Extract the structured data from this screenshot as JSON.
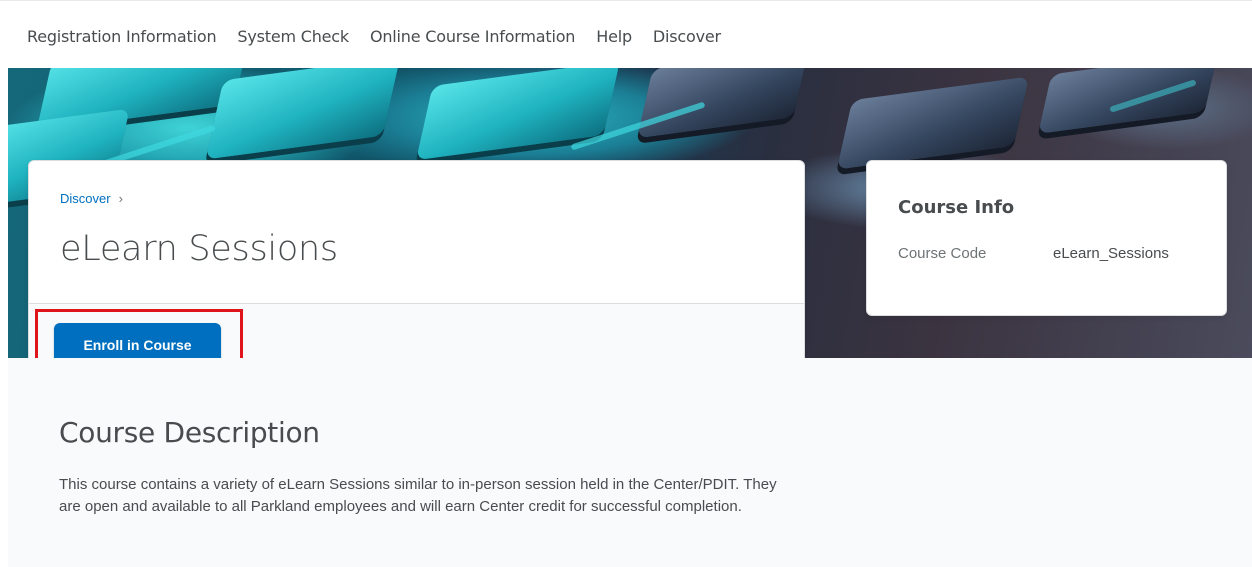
{
  "nav": {
    "items": [
      {
        "label": "Registration Information"
      },
      {
        "label": "System Check"
      },
      {
        "label": "Online Course Information"
      },
      {
        "label": "Help"
      },
      {
        "label": "Discover"
      }
    ]
  },
  "course": {
    "breadcrumb": "Discover",
    "breadcrumb_separator": "›",
    "title": "eLearn Sessions",
    "enroll_label": "Enroll in Course"
  },
  "course_info": {
    "heading": "Course Info",
    "code_label": "Course Code",
    "code_value": "eLearn_Sessions"
  },
  "description": {
    "heading": "Course Description",
    "text": "This course contains a variety of eLearn Sessions similar to in-person session held in the Center/PDIT.  They are open and available to all Parkland employees and will earn Center credit for successful completion."
  },
  "colors": {
    "accent": "#006fbf",
    "highlight": "#e0151b"
  },
  "icons": {
    "breadcrumb_chevron": "chevron-right-icon"
  }
}
